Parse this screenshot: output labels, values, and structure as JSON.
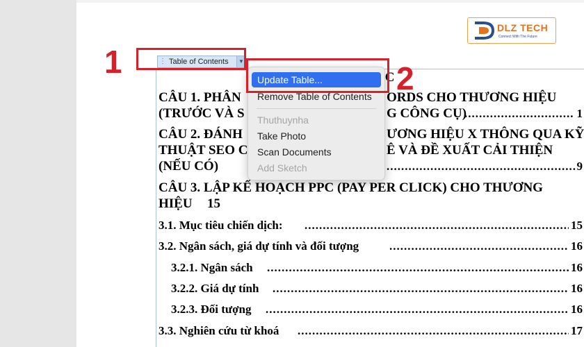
{
  "logo": {
    "brand": "DLZ TECH",
    "tagline": "Connect With The Future"
  },
  "toc_control": {
    "label": "Table of Contents",
    "grip": "⋮",
    "arrow": "▼"
  },
  "annotations": {
    "step1": "1",
    "step2": "2"
  },
  "context_menu": {
    "items": [
      {
        "label": "Update Table...",
        "state": "highlighted"
      },
      {
        "label": "Remove Table of Contents",
        "state": "enabled"
      },
      {
        "label": "Thuthuynha",
        "state": "disabled"
      },
      {
        "label": "Take Photo",
        "state": "enabled"
      },
      {
        "label": "Scan Documents",
        "state": "enabled"
      },
      {
        "label": "Add Sketch",
        "state": "disabled"
      }
    ]
  },
  "document": {
    "toc_heading_visible": "ỤC",
    "entries": [
      {
        "line1": "CÂU 1.  PHÂN",
        "line1_right": "ORDS CHO THƯƠNG HIỆU",
        "line2": "(TRƯỚC VÀ S",
        "line2_right": "G CÔNG CỤ)",
        "page": "1"
      },
      {
        "line1": "CÂU 2.  ĐÁNH",
        "line1_right": "ƯƠNG HIỆU X THÔNG QUA KỸ",
        "line2": "THUẬT SEO C",
        "line2_right": "Ê VÀ ĐỀ XUẤT CẢI THIỆN",
        "line3": "(NẾU CÓ)",
        "page": "9"
      },
      {
        "line1": "CÂU 3.  LẬP KẾ HOẠCH PPC (PAY PER CLICK) CHO THƯƠNG",
        "line2": "HIỆU",
        "page": "15"
      },
      {
        "text": "3.1. Mục tiêu chiến dịch:",
        "page": "15"
      },
      {
        "text": "3.2. Ngân sách, giá dự tính và đối tượng",
        "page": "16"
      },
      {
        "text": "3.2.1. Ngân sách",
        "page": "16"
      },
      {
        "text": "3.2.2. Giá dự tính",
        "page": "16"
      },
      {
        "text": "3.2.3. Đối tượng",
        "page": "16"
      },
      {
        "text": "3.3. Nghiên cứu từ khoá",
        "page": "17"
      }
    ]
  },
  "colors": {
    "annotation_red": "#d6202a",
    "menu_highlight": "#2f6ff0",
    "brand_orange": "#e2731f"
  }
}
